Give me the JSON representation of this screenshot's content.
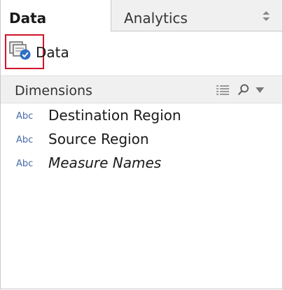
{
  "tabs": [
    {
      "label": "Data",
      "active": true
    },
    {
      "label": "Analytics",
      "active": false
    }
  ],
  "data_source": {
    "label": "Data",
    "icon": "data-source-icon"
  },
  "dimensions": {
    "header": "Dimensions",
    "fields": [
      {
        "type_label": "Abc",
        "name": "Destination Region"
      },
      {
        "type_label": "Abc",
        "name": "Source Region"
      },
      {
        "type_label": "Abc",
        "name": "Measure Names"
      }
    ]
  },
  "colors": {
    "highlight": "#d0142a",
    "abc": "#4a6aa8",
    "header_bg": "#f0f0f0"
  }
}
